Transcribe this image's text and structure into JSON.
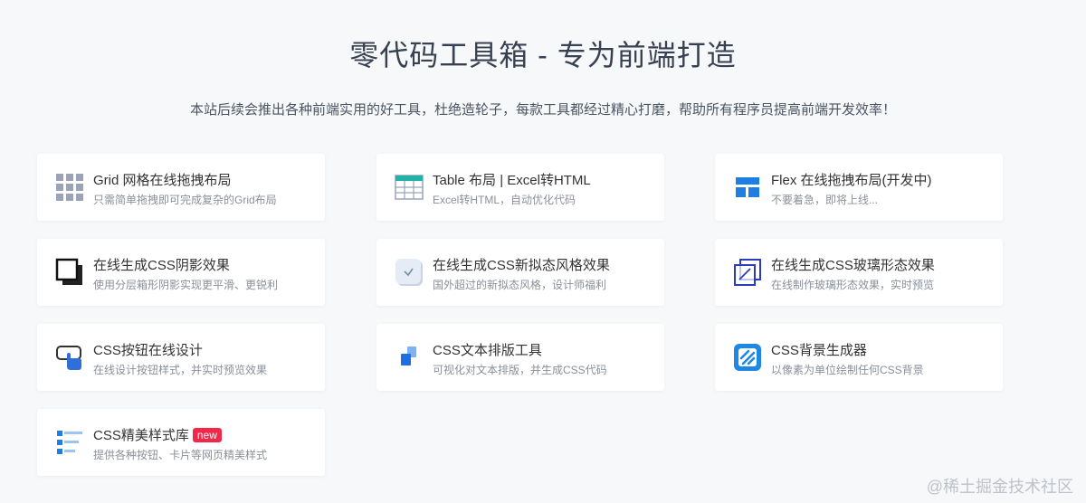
{
  "header": {
    "title": "零代码工具箱 - 专为前端打造",
    "subtitle": "本站后续会推出各种前端实用的好工具，杜绝造轮子，每款工具都经过精心打磨，帮助所有程序员提高前端开发效率！"
  },
  "tools": [
    {
      "name": "Grid 网格在线拖拽布局",
      "desc": "只需简单拖拽即可完成复杂的Grid布局",
      "icon": "grid-icon"
    },
    {
      "name": "Table 布局 | Excel转HTML",
      "desc": "Excel转HTML，自动优化代码",
      "icon": "table-icon"
    },
    {
      "name": "Flex 在线拖拽布局(开发中)",
      "desc": "不要着急，即将上线...",
      "icon": "flex-layout-icon"
    },
    {
      "name": "在线生成CSS阴影效果",
      "desc": "使用分层箱形阴影实现更平滑、更锐利",
      "icon": "shadow-icon"
    },
    {
      "name": "在线生成CSS新拟态风格效果",
      "desc": "国外超过的新拟态风格，设计师福利",
      "icon": "neumorphism-icon"
    },
    {
      "name": "在线生成CSS玻璃形态效果",
      "desc": "在线制作玻璃形态效果，实时预览",
      "icon": "glass-icon"
    },
    {
      "name": "CSS按钮在线设计",
      "desc": "在线设计按钮样式，并实时预览效果",
      "icon": "button-click-icon"
    },
    {
      "name": "CSS文本排版工具",
      "desc": "可视化对文本排版，并生成CSS代码",
      "icon": "text-layout-icon"
    },
    {
      "name": "CSS背景生成器",
      "desc": "以像素为单位绘制任何CSS背景",
      "icon": "background-pattern-icon"
    },
    {
      "name": "CSS精美样式库",
      "desc": "提供各种按钮、卡片等网页精美样式",
      "icon": "style-library-icon",
      "badge": "new"
    }
  ],
  "watermark": "@稀土掘金技术社区",
  "colors": {
    "background": "#f7f8fa",
    "card": "#ffffff",
    "accent_blue": "#1e7fe0",
    "badge_red": "#f0284a"
  }
}
